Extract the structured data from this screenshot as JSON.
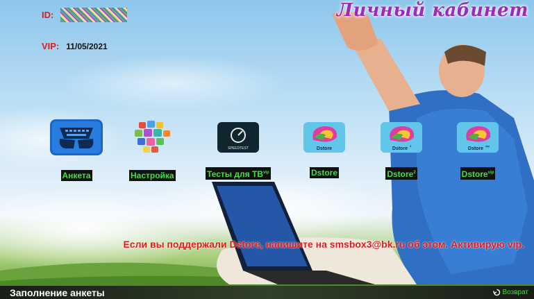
{
  "header": {
    "id_label": "ID:",
    "vip_label": "VIP:",
    "vip_date": "11/05/2021",
    "cabinet_title": "Личный кабинет"
  },
  "tiles": [
    {
      "label": "Анкета",
      "icon": "keyboard-icon"
    },
    {
      "label": "Настройка",
      "icon": "apps-cube-icon"
    },
    {
      "label": "Тесты для ТВ",
      "sup": "vip",
      "icon": "speedtest-icon"
    },
    {
      "label": "Dstore",
      "icon": "dstore-icon",
      "badge": "Dstore"
    },
    {
      "label": "Dstore",
      "sup": "2",
      "icon": "dstore2-icon",
      "badge": "Dstore",
      "badge_sup": "2"
    },
    {
      "label": "Dstore",
      "sup": "vip",
      "icon": "dstore-vip-icon",
      "badge": "Dstore",
      "badge_sup": "vip"
    }
  ],
  "speedtest_label": "SPEEDTEST",
  "notice": "Если вы поддержали Dstore, напишите на smsbox3@bk.ru об этом. Активирую vip.",
  "footer": {
    "title": "Заполнение анкеты",
    "back_label": "Возврат"
  },
  "colors": {
    "label_red": "#e01b1b",
    "caption_green": "#3fe23f",
    "title_purple": "#a02ab8"
  }
}
